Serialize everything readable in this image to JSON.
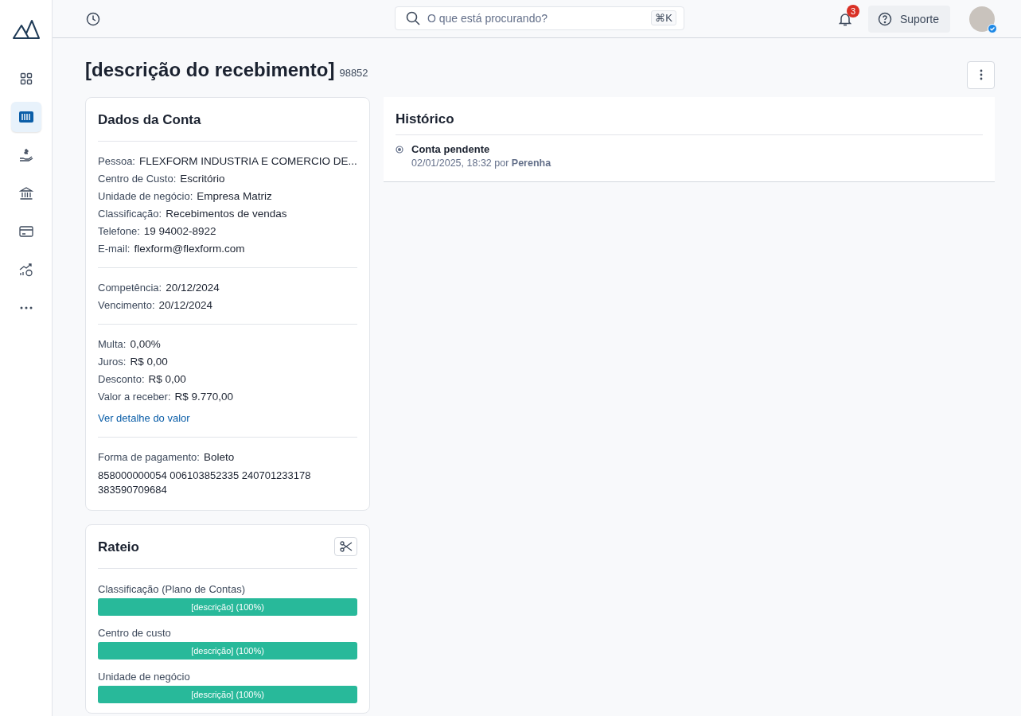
{
  "sidebar": {
    "items": [
      {
        "selected": false
      },
      {
        "selected": true
      },
      {
        "selected": false
      },
      {
        "selected": false
      },
      {
        "selected": false
      },
      {
        "selected": false
      },
      {
        "selected": false
      }
    ]
  },
  "topbar": {
    "search": {
      "placeholder": "O que está procurando?",
      "shortcut": "⌘K"
    },
    "notifications": {
      "count": "3"
    },
    "support": {
      "label": "Suporte"
    }
  },
  "page": {
    "title": "[descrição do recebimento]",
    "number": "98852"
  },
  "account": {
    "title": "Dados da Conta",
    "groups": [
      {
        "fields": [
          {
            "label": "Pessoa:",
            "value": "FLEXFORM INDUSTRIA E COMERCIO DE..."
          },
          {
            "label": "Centro de Custo:",
            "value": "Escritório"
          },
          {
            "label": "Unidade de negócio:",
            "value": "Empresa Matriz"
          },
          {
            "label": "Classificação:",
            "value": "Recebimentos de vendas"
          },
          {
            "label": "Telefone:",
            "value": "19 94002-8922"
          },
          {
            "label": "E-mail:",
            "value": "flexform@flexform.com"
          }
        ]
      },
      {
        "fields": [
          {
            "label": "Competência:",
            "value": "20/12/2024"
          },
          {
            "label": "Vencimento:",
            "value": "20/12/2024"
          }
        ]
      },
      {
        "fields": [
          {
            "label": "Multa:",
            "value": "0,00%"
          },
          {
            "label": "Juros:",
            "value": "R$ 0,00"
          },
          {
            "label": "Desconto:",
            "value": "R$ 0,00"
          },
          {
            "label": "Valor a receber:",
            "value": "R$ 9.770,00"
          }
        ],
        "link": "Ver detalhe do valor"
      },
      {
        "fields": [
          {
            "label": "Forma de pagamento:",
            "value": "Boleto"
          }
        ],
        "code": "858000000054 006103852335 240701233178 383590709684"
      }
    ]
  },
  "rateio": {
    "title": "Rateio",
    "rows": [
      {
        "label": "Classificação (Plano de Contas)",
        "bar": "[descrição] (100%)",
        "level": 1
      },
      {
        "label": "Centro de custo",
        "bar": "[descrição] (100%)",
        "level": 1
      },
      {
        "label": "Unidade de negócio",
        "bar": "[descrição] (100%)",
        "level": 1
      }
    ]
  },
  "history": {
    "title": "Histórico",
    "events": [
      {
        "title": "Conta pendente",
        "date": "02/01/2025, 18:32 por",
        "user": "Perenha"
      }
    ]
  }
}
